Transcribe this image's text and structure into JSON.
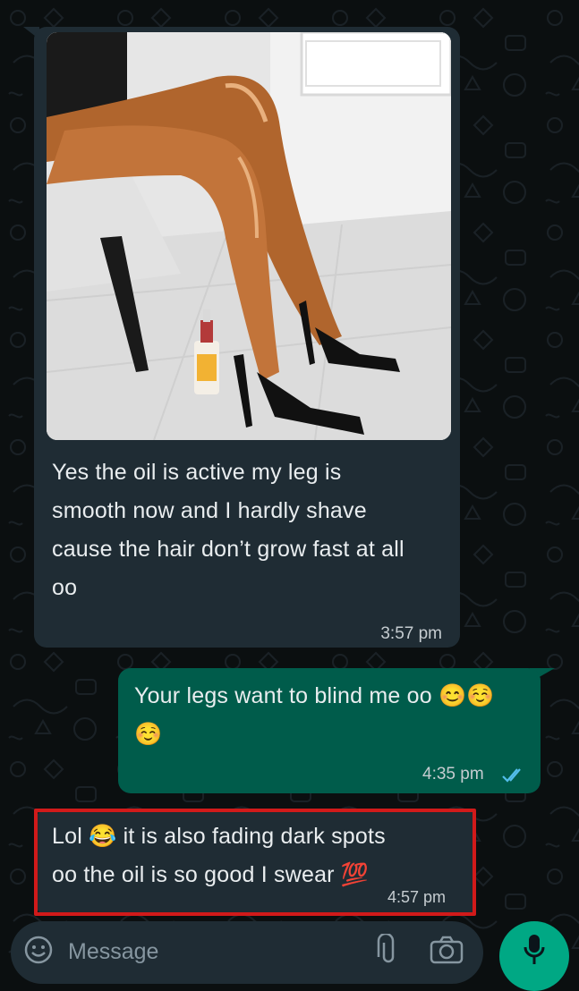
{
  "colors": {
    "background": "#0b0f10",
    "incoming_bubble": "#1f2c34",
    "outgoing_bubble": "#005c4b",
    "accent_green": "#00a884",
    "read_ticks": "#53bdeb",
    "highlight_border": "#d11a1a"
  },
  "messages": [
    {
      "direction": "incoming",
      "has_photo": true,
      "lines": [
        "Yes the oil is active my leg is",
        "smooth now and I hardly shave",
        "cause the hair don’t grow fast at all",
        "oo"
      ],
      "time": "3:57 pm"
    },
    {
      "direction": "outgoing",
      "lines": [
        "Your legs want to blind me oo 😊☺️",
        "☺️"
      ],
      "time": "4:35 pm",
      "status_icon": "double-check-read-icon"
    },
    {
      "direction": "incoming",
      "lines": [
        "Lol 😂 it is also fading dark spots",
        "oo the oil is so good I swear 💯"
      ],
      "time": "4:57 pm",
      "highlighted": true
    }
  ],
  "composer": {
    "placeholder": "Message",
    "icons": [
      "emoji-icon",
      "attach-icon",
      "camera-icon",
      "mic-icon"
    ]
  }
}
